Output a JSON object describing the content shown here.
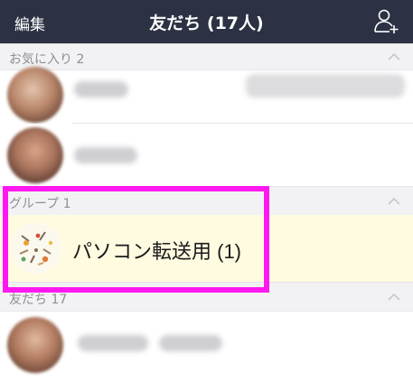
{
  "header": {
    "edit_label": "編集",
    "title": "友だち (17人)",
    "add_friend_icon": "add-friend-icon"
  },
  "sections": {
    "favorites": "お気に入り 2",
    "groups": "グループ 1",
    "friends": "友だち 17"
  },
  "groups": {
    "items": [
      {
        "name": "パソコン転送用 (1)"
      }
    ]
  },
  "colors": {
    "header_bg": "#2c3243",
    "section_bg": "#f2f2f4",
    "group_row_bg": "#fffbe0",
    "highlight": "#ff19f0"
  }
}
